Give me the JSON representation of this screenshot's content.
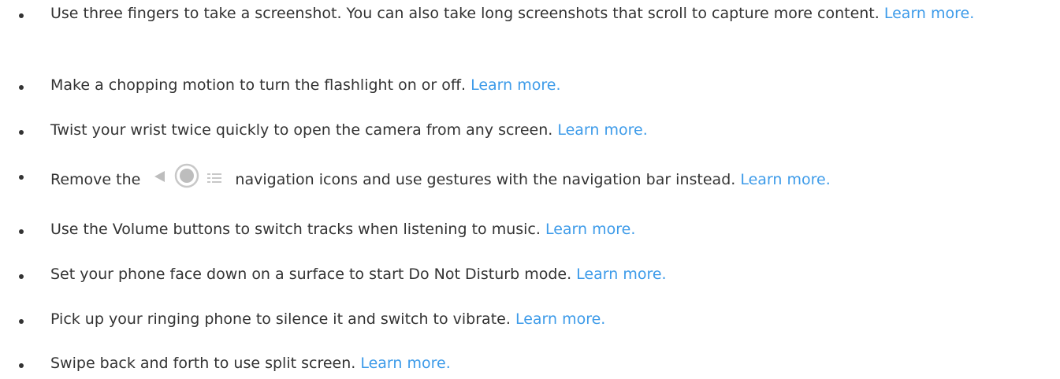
{
  "link_color": "#3d9be9",
  "text_color": "#333333",
  "tips": [
    {
      "text": "Use three fingers to take a screenshot. You can also take long screenshots that scroll to capture more content.",
      "link": "Learn more."
    },
    {
      "text": "Make a chopping motion to turn the flashlight on or off.",
      "link": "Learn more."
    },
    {
      "text": "Twist your wrist twice quickly to open the camera from any screen.",
      "link": "Learn more."
    },
    {
      "text_before_icons": "Remove the",
      "icons": [
        "back-arrow-icon",
        "home-circle-icon",
        "recents-icon"
      ],
      "text_after_icons": "navigation icons and use gestures with the navigation bar instead.",
      "link": "Learn more."
    },
    {
      "text": "Use the Volume buttons to switch tracks when listening to music.",
      "link": "Learn more."
    },
    {
      "text": "Set your phone face down on a surface to start Do Not Disturb mode.",
      "link": "Learn more."
    },
    {
      "text": "Pick up your ringing phone to silence it and switch to vibrate.",
      "link": "Learn more."
    },
    {
      "text": "Swipe back and forth to use split screen.",
      "link": "Learn more."
    }
  ]
}
